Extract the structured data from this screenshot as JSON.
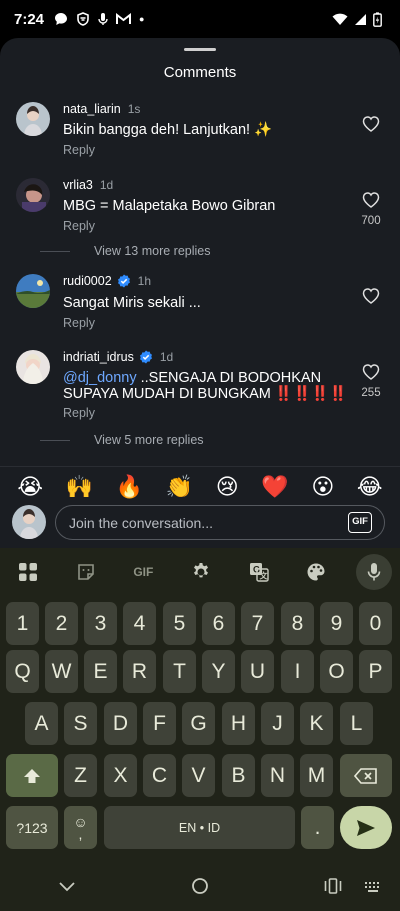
{
  "status": {
    "time": "7:24"
  },
  "sheet": {
    "title": "Comments"
  },
  "comments": [
    {
      "user": "nata_liarin",
      "verified": false,
      "time": "1s",
      "text": "Bikin bangga deh! Lanjutkan! ✨",
      "reply": "Reply",
      "likes": ""
    },
    {
      "user": "vrlia3",
      "verified": false,
      "time": "1d",
      "text": "MBG = Malapetaka Bowo Gibran",
      "reply": "Reply",
      "likes": "700",
      "view_replies": "View 13 more replies"
    },
    {
      "user": "rudi0002",
      "verified": true,
      "time": "1h",
      "text": "Sangat Miris sekali ...",
      "reply": "Reply",
      "likes": ""
    },
    {
      "user": "indriati_idrus",
      "verified": true,
      "time": "1d",
      "mention": "@dj_donny",
      "text": " ..SENGAJA DI BODOHKAN SUPAYA MUDAH DI BUNGKAM ‼️‼️‼️‼️",
      "reply": "Reply",
      "likes": "255",
      "view_replies": "View 5 more replies"
    }
  ],
  "emoji_bar": [
    "😭",
    "🙌",
    "🔥",
    "👏",
    "😢",
    "❤️",
    "😮",
    "😂"
  ],
  "composer": {
    "placeholder": "Join the conversation...",
    "gif_label": "GIF"
  },
  "keyboard": {
    "toolbar": [
      "apps-icon",
      "sticker-icon",
      "GIF",
      "gear-icon",
      "translate-icon",
      "palette-icon",
      "mic-icon"
    ],
    "toolbar_gif": "GIF",
    "row_numbers": [
      "1",
      "2",
      "3",
      "4",
      "5",
      "6",
      "7",
      "8",
      "9",
      "0"
    ],
    "row_1": [
      "Q",
      "W",
      "E",
      "R",
      "T",
      "Y",
      "U",
      "I",
      "O",
      "P"
    ],
    "row_2": [
      "A",
      "S",
      "D",
      "F",
      "G",
      "H",
      "J",
      "K",
      "L"
    ],
    "row_3": [
      "Z",
      "X",
      "C",
      "V",
      "B",
      "N",
      "M"
    ],
    "symbols_label": "?123",
    "emoji_label_top": "☺",
    "emoji_label_bottom": ",",
    "space_label": "EN • ID",
    "period_label": "."
  },
  "colors": {
    "sheet_bg": "#1a1d22",
    "keyboard_bg": "#202319",
    "accent_green": "#c8d6a8",
    "link_blue": "#6ea8ff"
  }
}
